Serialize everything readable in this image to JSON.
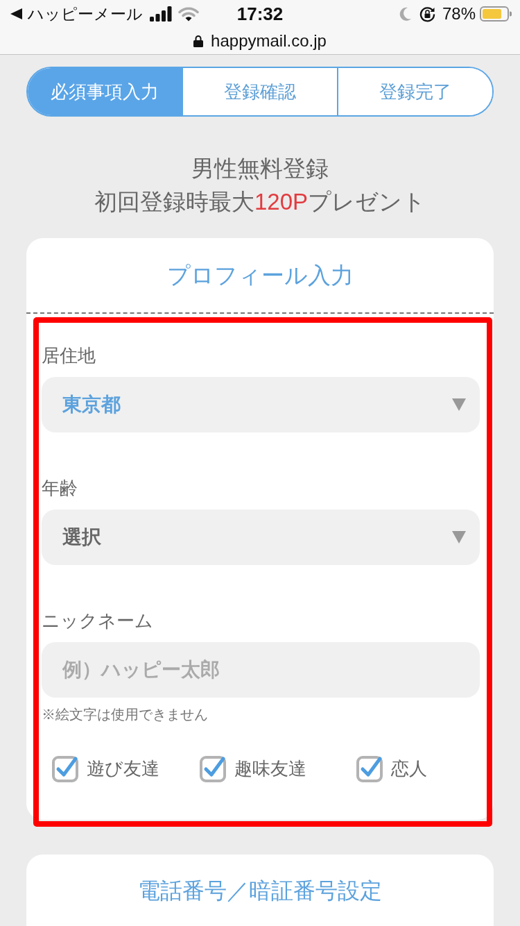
{
  "status_bar": {
    "app_name": "ハッピーメール",
    "time": "17:32",
    "battery": "78%"
  },
  "address_bar": {
    "url": "happymail.co.jp"
  },
  "steps": [
    {
      "label": "必須事項入力",
      "selected": true
    },
    {
      "label": "登録確認",
      "selected": false
    },
    {
      "label": "登録完了",
      "selected": false
    }
  ],
  "heading": {
    "title": "男性無料登録",
    "subtitle": [
      {
        "text": "初回登録時最大",
        "highlight": false
      },
      {
        "text": "120P",
        "highlight": true
      },
      {
        "text": "プレゼント",
        "highlight": false
      }
    ]
  },
  "profile_card": {
    "title": "プロフィール入力",
    "fields": [
      {
        "kind": "select",
        "label": "居住地",
        "value": "東京都"
      },
      {
        "kind": "select",
        "label": "年齢",
        "placeholder": "選択"
      },
      {
        "kind": "text",
        "label": "ニックネーム",
        "placeholder": "例）ハッピー太郎",
        "note": "※絵文字は使用できません"
      }
    ],
    "purposes": [
      {
        "label": "遊び友達",
        "checked": true
      },
      {
        "label": "趣味友達",
        "checked": true
      },
      {
        "label": "恋人",
        "checked": true
      }
    ]
  },
  "phone_card": {
    "title": "電話番号／暗証番号設定"
  }
}
